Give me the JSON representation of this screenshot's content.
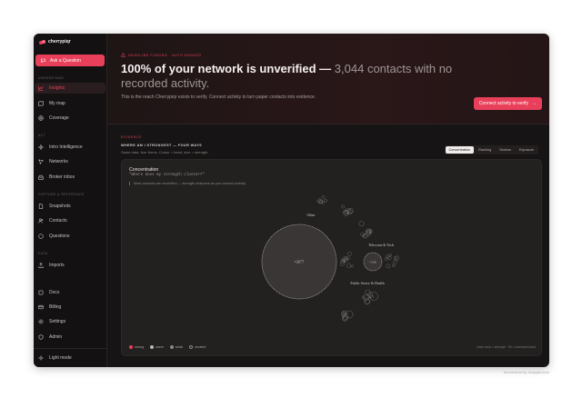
{
  "app": {
    "logo_text": "cherrypiqr",
    "brand_color": "#e8405a"
  },
  "sidebar": {
    "ask_label": "Ask a Question",
    "sections": [
      {
        "label": "Understand",
        "items": [
          {
            "label": "Insights",
            "icon": "chart-line-icon",
            "active": true
          },
          {
            "label": "My map",
            "icon": "map-icon"
          },
          {
            "label": "Coverage",
            "icon": "target-icon"
          }
        ]
      },
      {
        "label": "Act",
        "items": [
          {
            "label": "Intro Intelligence",
            "icon": "sparkle-icon"
          },
          {
            "label": "Networks",
            "icon": "network-icon"
          },
          {
            "label": "Broker inbox",
            "icon": "inbox-icon"
          }
        ]
      },
      {
        "label": "Capture & Reference",
        "items": [
          {
            "label": "Snapshots",
            "icon": "document-icon"
          },
          {
            "label": "Contacts",
            "icon": "people-icon"
          },
          {
            "label": "Questions",
            "icon": "chat-icon"
          }
        ]
      },
      {
        "label": "Data",
        "items": [
          {
            "label": "Imports",
            "icon": "upload-icon"
          }
        ]
      },
      {
        "label": "",
        "items": [
          {
            "label": "Docs",
            "icon": "book-icon"
          },
          {
            "label": "Billing",
            "icon": "card-icon"
          },
          {
            "label": "Settings",
            "icon": "gear-icon"
          },
          {
            "label": "Admin",
            "icon": "shield-icon"
          }
        ]
      }
    ],
    "theme_toggle": "Light mode"
  },
  "banner": {
    "tag": "HEADLINE FINDING · AUTO RANKED",
    "headline_strong": "100% of your network is unverified —",
    "headline_muted": "3,044 contacts with no recorded activity.",
    "subline": "This is the reach Cherrypiqr exists to verify. Connect activity to turn paper contacts into evidence.",
    "cta": "Connect activity to verify",
    "cta_arrow": "→"
  },
  "evidence": {
    "label": "EVIDENCE",
    "title": "WHERE AM I STRONGEST — FOUR WAYS",
    "subtitle": "Same data, four forms. Colour = band, size = strength.",
    "tabs": [
      {
        "label": "Concentration",
        "active": true
      },
      {
        "label": "Ranking"
      },
      {
        "label": "Sectors"
      },
      {
        "label": "Exposure"
      }
    ]
  },
  "panel": {
    "title": "Concentration",
    "question": "\"Where does my strength cluster?\"",
    "note": "Most contacts are unverified — strength sharpens as you connect activity.",
    "legend": [
      {
        "label": "strong",
        "color": "#e8405a"
      },
      {
        "label": "warm",
        "color": "#bdb6b6"
      },
      {
        "label": "weak",
        "color": "#8d8686"
      },
      {
        "label": "unrated",
        "color": "#3a3535"
      }
    ],
    "footer": "circle area = strength · 96 × dominant band"
  },
  "chart_data": {
    "type": "bubble-pack",
    "clusters": [
      {
        "name": "",
        "value_label": "≈2677",
        "value": 2677
      },
      {
        "name": "Telecoms & Tech",
        "value_label": "≈136",
        "value": 136
      },
      {
        "name": "Other",
        "value": 0
      },
      {
        "name": "Public Sector & Health",
        "value": 0
      }
    ],
    "size_encodes": "strength",
    "color_encodes": "band"
  },
  "watermark": "Screenshot by Xnapper.com"
}
